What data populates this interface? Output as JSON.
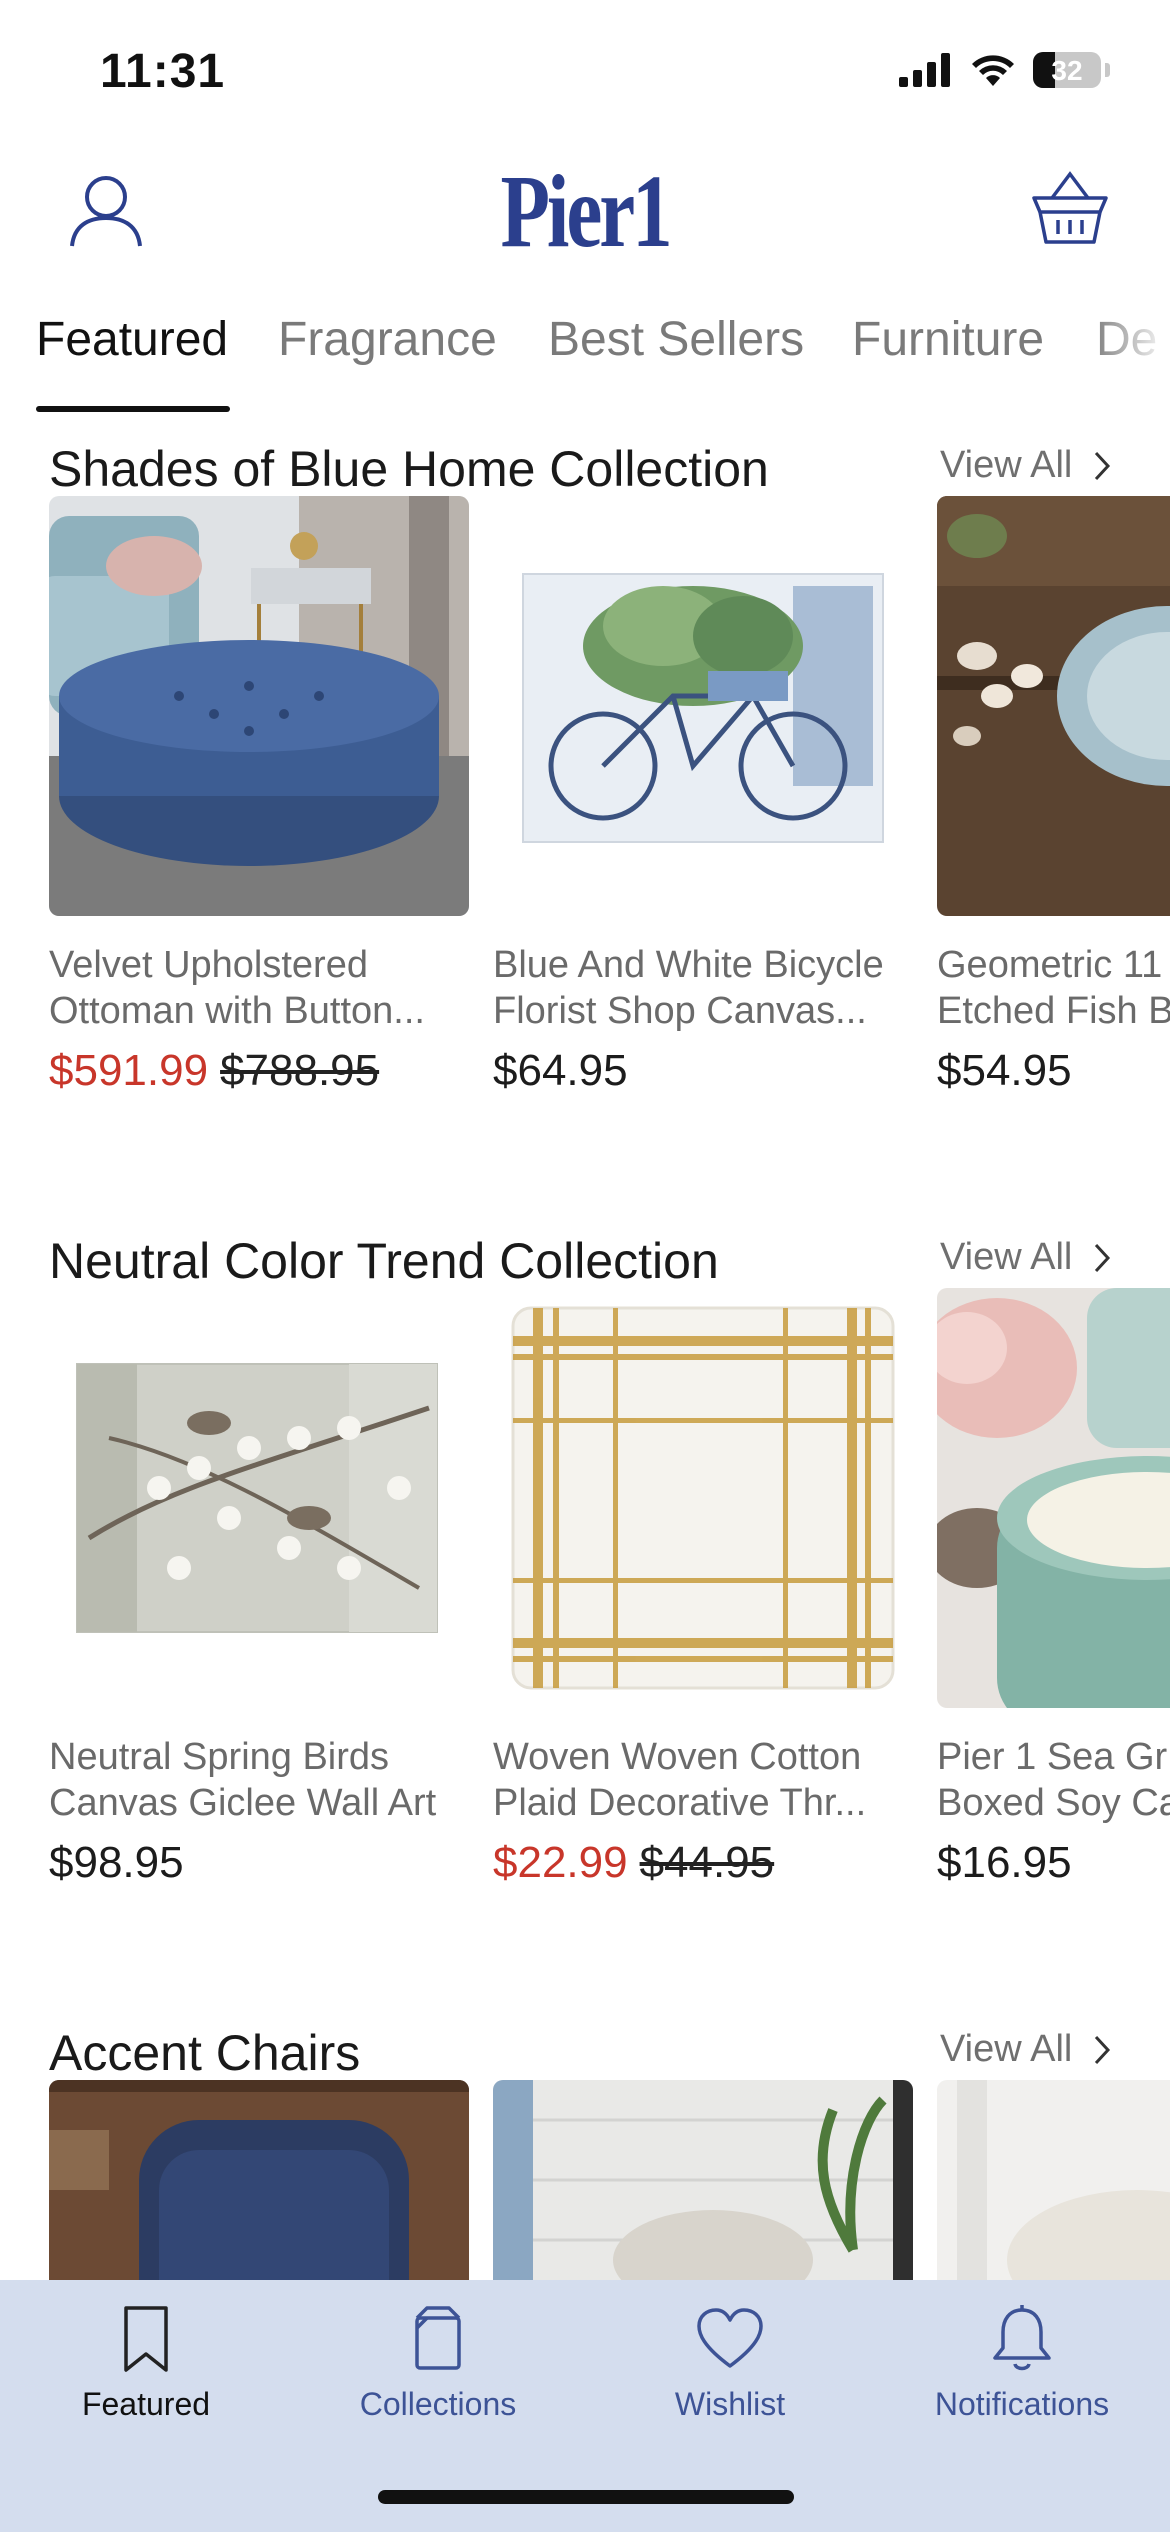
{
  "status_bar": {
    "time": "11:31",
    "battery": "32"
  },
  "header": {
    "logo": "Pier1"
  },
  "tabs": [
    {
      "label": "Featured"
    },
    {
      "label": "Fragrance"
    },
    {
      "label": "Best Sellers"
    },
    {
      "label": "Furniture"
    },
    {
      "label": "De"
    }
  ],
  "sections": [
    {
      "title": "Shades of Blue Home Collection",
      "view_all": "View All",
      "products": [
        {
          "line1": "Velvet Upholstered",
          "line2": "Ottoman with Button...",
          "sale_price": "$591.99",
          "original_price": "$788.95"
        },
        {
          "line1": "Blue And White Bicycle",
          "line2": "Florist Shop Canvas...",
          "price": "$64.95"
        },
        {
          "line1": "Geometric 11",
          "line2": "Etched Fish B",
          "price": "$54.95"
        }
      ]
    },
    {
      "title": "Neutral Color Trend Collection",
      "view_all": "View All",
      "products": [
        {
          "line1": "Neutral Spring Birds",
          "line2": "Canvas Giclee Wall Art",
          "price": "$98.95"
        },
        {
          "line1": "Woven Woven Cotton",
          "line2": "Plaid Decorative Thr...",
          "sale_price": "$22.99",
          "original_price": "$44.95"
        },
        {
          "line1": "Pier 1 Sea Gr",
          "line2": "Boxed Soy Ca",
          "price": "$16.95"
        }
      ]
    },
    {
      "title": "Accent Chairs",
      "view_all": "View All"
    }
  ],
  "bottom_nav": [
    {
      "label": "Featured",
      "icon": "bookmark-icon",
      "active": true
    },
    {
      "label": "Collections",
      "icon": "collections-icon",
      "active": false
    },
    {
      "label": "Wishlist",
      "icon": "heart-icon",
      "active": false
    },
    {
      "label": "Notifications",
      "icon": "bell-icon",
      "active": false
    }
  ],
  "colors": {
    "brand": "#2b3f8d",
    "sale": "#c8362a",
    "nav_bg": "#d4ddee",
    "nav_text": "#3d5396"
  }
}
